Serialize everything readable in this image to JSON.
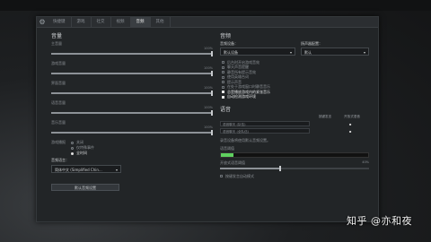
{
  "tabs": [
    "快捷键",
    "游戏",
    "社交",
    "视频",
    "音频",
    "其他"
  ],
  "active_tab": 4,
  "volume": {
    "title": "音量",
    "sliders": [
      {
        "label": "主音量",
        "value": 100,
        "value_text": "100%"
      },
      {
        "label": "游戏音量",
        "value": 100,
        "value_text": "100%"
      },
      {
        "label": "界面音量",
        "value": 100,
        "value_text": "100%"
      },
      {
        "label": "语音音量",
        "value": 100,
        "value_text": "100%"
      },
      {
        "label": "音乐音量",
        "value": 100,
        "value_text": "100%"
      }
    ],
    "speech_label": "游戏播报",
    "radios": [
      {
        "label": "关闭",
        "selected": false
      },
      {
        "label": "仅特殊事件",
        "selected": false
      },
      {
        "label": "全时间",
        "selected": true
      }
    ],
    "language_label": "音频语言：",
    "language_value": "简体中文 (Simplified Chin...",
    "reset_button": "默认音频设置"
  },
  "audio": {
    "title": "音频",
    "output_label": "音频设备：",
    "output_value": "默认设备",
    "speaker_label": "扬声器配置：",
    "speaker_value": "默认",
    "checks": [
      {
        "label": "后台时开启游戏音效",
        "checked": false
      },
      {
        "label": "聊天声音提醒",
        "checked": false
      },
      {
        "label": "静音所有提示音效",
        "checked": false
      },
      {
        "label": "使用英雄台词",
        "checked": false
      },
      {
        "label": "提示声音",
        "checked": false
      },
      {
        "label": "在处于游戏窗口时静音音乐",
        "checked": false
      },
      {
        "label": "总是播放游戏内的紧张音乐",
        "checked": true
      },
      {
        "label": "自动检测游戏环境",
        "checked": true
      }
    ]
  },
  "voice": {
    "title": "语音",
    "col_headers": [
      "按键发言",
      "开放式语音"
    ],
    "rows": [
      {
        "label": "语音聊天 (队伍)"
      },
      {
        "label": "语音聊天 (全队伍)"
      }
    ],
    "device_label": "录音设备将使用默认音频设置。",
    "threshold_label": "语音阈值",
    "open_mic_label": "开放式语音阈值",
    "open_mic_value": "40%",
    "last_check": "按键发言自动模式"
  },
  "watermark": "知乎 @亦和夜"
}
